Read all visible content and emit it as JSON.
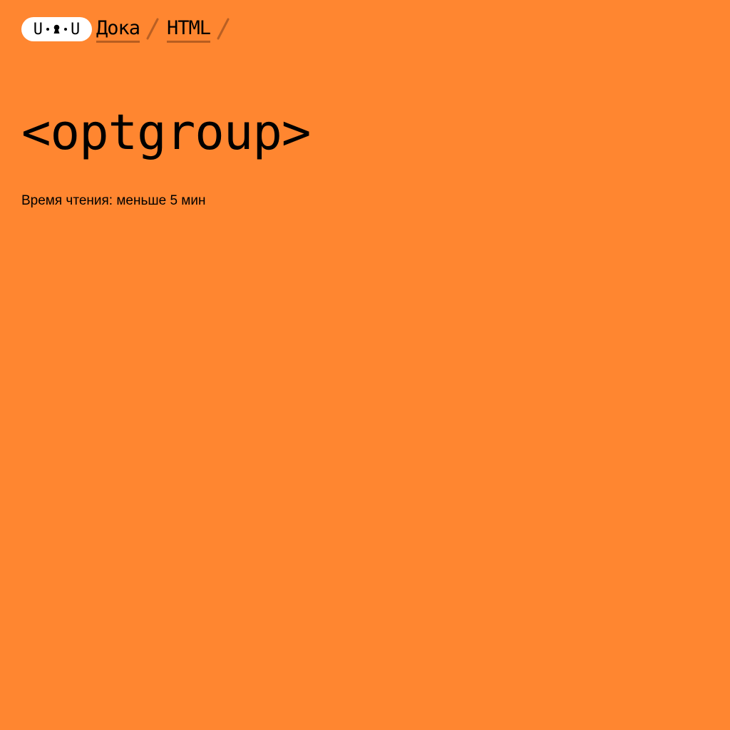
{
  "site": {
    "logo_text": [
      "U",
      "U"
    ],
    "logo_name": "doka-logo-icon"
  },
  "breadcrumb": {
    "items": [
      {
        "label": "Дока"
      },
      {
        "label": "HTML"
      }
    ]
  },
  "article": {
    "title": "<optgroup>",
    "reading_time": "Время чтения: меньше 5 мин"
  },
  "colors": {
    "background": "#ff8630",
    "logo_background": "#ffffff",
    "text": "#000000",
    "link_underline": "#b85d1f",
    "separator": "#b95f23"
  }
}
